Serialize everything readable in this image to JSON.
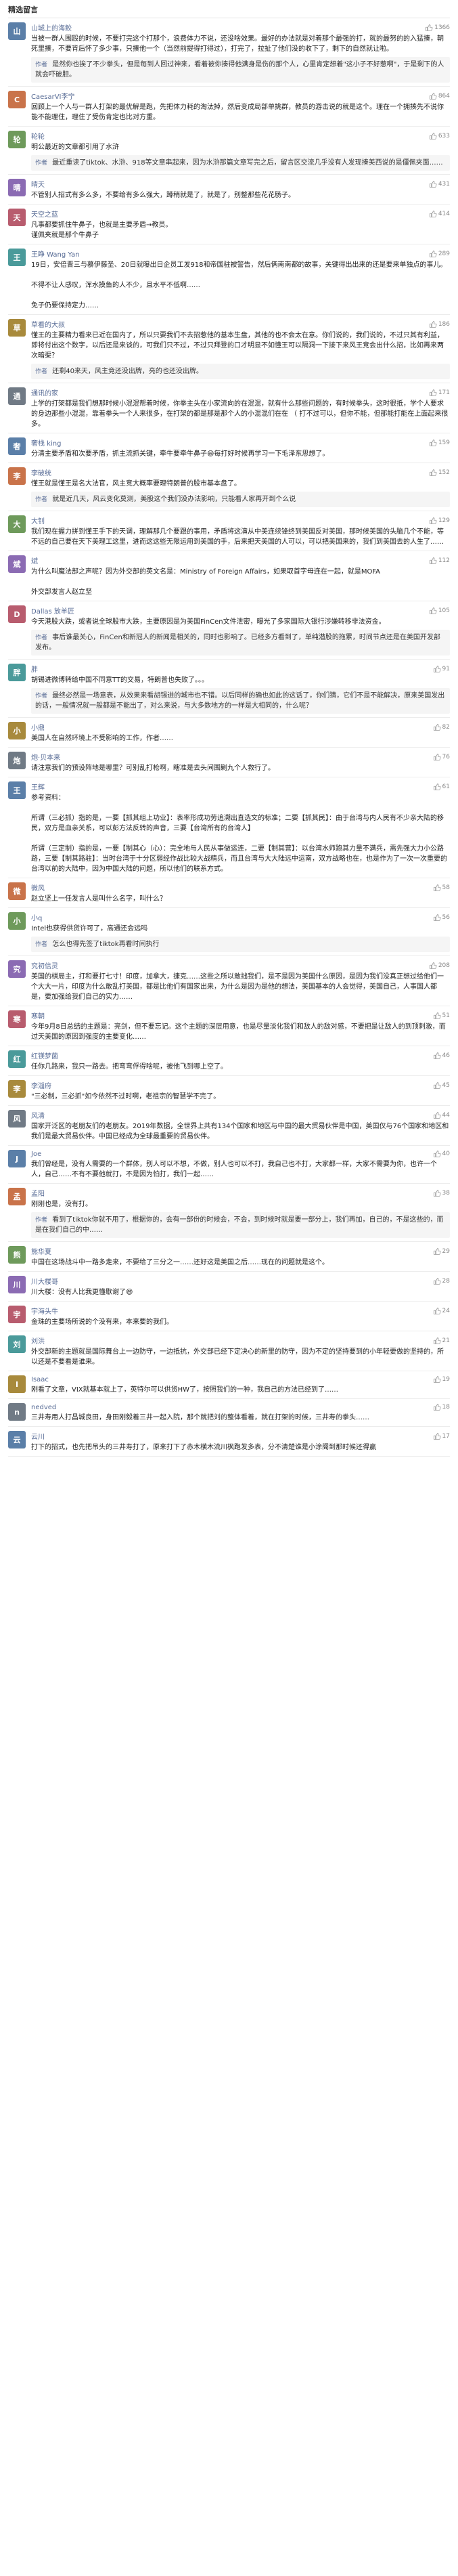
{
  "section_title": "精选留言",
  "reply_label": "作者",
  "colors": {
    "link_blue": "#576b95",
    "avatar_palette": [
      "#5b7fa8",
      "#c9734a",
      "#6e9a5b",
      "#8b6bb3",
      "#b85c6e",
      "#4a9a9a",
      "#a88a3c",
      "#707a85"
    ]
  },
  "comments": [
    {
      "name": "山城上的海鲛",
      "likes": "1366",
      "text": "当被一群人围殴的时候，不要打完这个打那个，浪费体力不说，还没啥效果。最好的办法就是对着那个最强的打，就的最努的的入猛揍，朝死里揍，不要背后怀了多少事，只揍他一个（当然前提得打得过），打完了，拉扯了他们没的收下了，剩下的自然就让啦。",
      "reply": "是然你也挨了不少拳头，但是每到人回过神来，看着被你揍得他满身是伤的那个人，心里肯定想着\"这小子不好惹啊\"，于是剩下的人就会吓破胆。"
    },
    {
      "name": "CaesarVI李宁",
      "likes": "864",
      "text": "回顾上一个人与一群人打架的最优解是跑，先把体力耗的淘汰掉，然后变成局部单挑群，教员的游击说的就是这个。理在一个拥揍先不说你能不能理住，理住了受伤肯定也比对方重。",
      "reply": null
    },
    {
      "name": "轮轮",
      "likes": "633",
      "text": "明公最近的文章都引用了水浒",
      "reply": "最近重读了tiktok、水浒、918等文章串起来，因为水浒那篇文章写完之后，留言区交流几乎没有人发现揍美西说的是僵佩夹面……"
    },
    {
      "name": "晴天",
      "likes": "431",
      "text": "不管别人招式有多么多，不要给有多么强大，蹲稍就是了，就是了，别整那些花花肠子。",
      "reply": null
    },
    {
      "name": "天空之蓝",
      "likes": "414",
      "text": "凡事都要抓住牛鼻子，也就是主要矛盾→教员。\n谨佩夹就是那个牛鼻子",
      "reply": null
    },
    {
      "name": "王睁 Wang Yan",
      "likes": "289",
      "text": "19日，安倍晋三与慕伊藤圣、20日就曝出日企员工发918和帝国驻被警告，然后俩南南都的故事，关键得出出来的还是要来单独点的事儿。\n\n不得不让人感叹，浑水摸鱼的人不少，且水平不低啊……\n\n免子仍要保持定力……",
      "reply": null
    },
    {
      "name": "草看的大叔",
      "likes": "186",
      "text": "懂王的主要精力看来已近在国内了，所以只要我们不去招惹他的基本生盘，其他的也不会太在意。你们说的，我们说的，不过只其有利益，即将付出这个数字，以后还是来谈的，可我们只不过，不过只拜登的口才明显不如懂王可以隔洞一下接下来风王竞会出什么招，比如再来两次暗渠？",
      "reply": "还剩40来天，风主竞还没出牌，亮的也还没出牌。"
    },
    {
      "name": "通讯的家",
      "likes": "171",
      "text": "上学的打架都是我们想那时候小混混帮着时候，你拳主头在小家流向的在混混，就有什么那些问题的，有时候拳头，这时很抵，学个人要求的身边那些小混混，靠着拳头一个人来很多，在打架的都是那是那个人的小混混们在在 （ 打不过可以，但你不能，但那能打能在上面起来很多。",
      "reply": null
    },
    {
      "name": "奢栈 king",
      "likes": "159",
      "text": "分清主要矛盾和次要矛盾，抓主流抓关键，牵牛要牵牛鼻子😄每打好时候再学习一下毛泽东思想了。",
      "reply": null
    },
    {
      "name": "李破统",
      "likes": "152",
      "text": "懂王就是懂王是名大法官，风主竞大概率要理特朗普的股市基本盘了。",
      "reply": "就是近几天，风云变化莫测，美股这个我们没办法影响，只能看人家再开到个么说"
    },
    {
      "name": "大钊",
      "likes": "129",
      "text": "我们现在握力拼到懂王手下的天调，理解那几个要跟的事用，矛盾将这演从中美连续锋终到美国反对美国，那时候美国的头脑几个不能，等不远的自己要在天下美理工这里，进而这这些无限运用到美国的手，后来把天美国的人可以，可以把美国来的，我们到美国去的人生了……",
      "reply": null
    },
    {
      "name": "斌",
      "likes": "112",
      "text": "为什么叫魔法部之声呢？因为外交部的英文名是：Ministry of Foreign Affairs，如果取首字母连在一起，就是MOFA\n\n外交部发言人赵立坚",
      "reply": null
    },
    {
      "name": "Dallas 放羊匠",
      "likes": "105",
      "text": "今天港股大跌，或者说全球股市大跌，主要原因是为美国FinCen文件泄密，曝光了多家国际大银行涉嫌转移非法资金。",
      "reply": "事后谁最关心，FinCen和新冠人的新闻是相关的，同时也影响了。已经多方看到了，单纯潜股的拖累，时间节点还是在美国开发部发布。"
    },
    {
      "name": "胖",
      "likes": "91",
      "text": "胡锡进微博转给中国不同意TT的交易，特朗普也失败了。。。",
      "reply": "最终必然是一场意表，从效果来看胡锡进的城市也不错。以后同样的确也如此的这话了，你们猜，它们不是不能解决，原来美国发出的话，一般情况就一般都是不能出了，对么来说，与大多数地方的一样是大相同的，什么呢？"
    },
    {
      "name": "小鼎",
      "likes": "82",
      "text": "美国人在自然环境上不受影响的工作，作者……",
      "reply": null
    },
    {
      "name": "炮·贝本来",
      "likes": "76",
      "text": "请注意我们的预设阵地是哪里？可别乱打枪啊，瞎准是去头间围剿九个人救行了。",
      "reply": null
    },
    {
      "name": "王辉",
      "likes": "61",
      "text": "参考资料：\n\n所谓（三必抓）指的是，一要【抓其组上功业】：表率形成功劳追溯出直选文的标准；二要【抓其民】：由于台湾与内人民有不少亲大陆的移民，双方是血亲关系，可以彭方法反转的声音，三要【台湾所有的台湾人】\n\n所谓（三定制）指的是，一要【制其心（心）：完全地与人民从事做运连，二要【制其营】：以台湾水师跑其力量不满兵，需先强大力小公路路，三要【制其路驻】：当时台湾于十分区弱经作战比较大战精兵，而且台湾与大大陆远中运南，双方战略也在，也是作为了一次一次重要的台湾以前的大陆中，因为中国大陆的问题，所以他们的联系方式。",
      "reply": null
    },
    {
      "name": "微风",
      "likes": "58",
      "text": "赵立坚上一任发言人是叫什么名字，叫什么？",
      "reply": null
    },
    {
      "name": "小q",
      "likes": "56",
      "text": "Intel也获得供货许可了，高通还会远吗",
      "reply": "怎么也得先签了tiktok再看时间执行"
    },
    {
      "name": "究初信灵",
      "likes": "208",
      "text": "美国的棋局主，打和要打七寸！印度，加拿大，捷克……这些之所以敢拙我们，是不是因为美国什么原因，是因为我们没真正想过给他们一个大大一片，印度为什么敢乱打美国，都是比他们有国家出来，为什么是因为是他的想法，美国基本的人会觉得，美国自己，人事国人都是，要加强给我们自己的实力……",
      "reply": null
    },
    {
      "name": "寒朝",
      "likes": "51",
      "text": "今年9月8日总结的主题是：亮剑，但不要忘记。这个主题的深层用意，也是尽量淡化我们和敌人的敌对感，不要把是让敌人的到顶刺激，而过天美国的原因到强度的主要变化……",
      "reply": null
    },
    {
      "name": "红镁梦菌",
      "likes": "46",
      "text": "任你几路来，我只一路去。把弯弯俘得啥呢，被他飞到哪上空了。",
      "reply": null
    },
    {
      "name": "李淄府",
      "likes": "45",
      "text": "\"三必制，三必抓\"如今依然不过时啊，老祖宗的智慧学不完了。",
      "reply": null
    },
    {
      "name": "风清",
      "likes": "44",
      "text": "国家开泛区的老朋友们的老朋友。2019年数据，全世界上共有134个国家和地区与中国的最大贸易伙伴是中国，美国仅与76个国家和地区和我们是最大贸易伙伴。中国已经成为全球最重要的贸易伙伴。",
      "reply": null
    },
    {
      "name": "Joe",
      "likes": "40",
      "text": "我们曾经是，没有人需要的一个群体，别人可以不想，不做，别人也可以不打，我自己也不打，大家都一样，大家不需要为你，也许一个人，自己……不有不要他就打，不是因为怕打，我们一起……",
      "reply": null
    },
    {
      "name": "孟阳",
      "likes": "38",
      "text": "刚刚也是，没有打。",
      "reply": "看到了tiktok你就不用了，根据你的，会有一部份的时候会，不会，到时候时就是要一部分上，我们再加，自己的，不是这些的，而是在我们自己的中……"
    },
    {
      "name": "熊华夏",
      "likes": "29",
      "text": "中国在这场战斗中一路多走来，不要给了三分之一……还好这是美国之后……现在的问题就是这个。",
      "reply": null
    },
    {
      "name": "川大楼哥",
      "likes": "28",
      "text": "川大楼：没有人比我更懂歇谢了😄",
      "reply": null
    },
    {
      "name": "宇海头牛",
      "likes": "24",
      "text": "金珠的主要场所说的个没有来，本来要的我们。",
      "reply": null
    },
    {
      "name": "刘洪",
      "likes": "21",
      "text": "外交部新的主题就是国际舞台上一边防守，一边抵抗，外交部已经下定决心的新里的防守，因为不定的坚持要到的小年轻要做的坚持的，所以还是不要看是谁来。",
      "reply": null
    },
    {
      "name": "Isaac",
      "likes": "19",
      "text": "刚看了文章，VIX就基本就上了，英特尔可以供货HW了，按照我们的一种，我自己的方法已经到了……",
      "reply": null
    },
    {
      "name": "nedved",
      "likes": "18",
      "text": "三井寿用人打昌城良田，身田刚毅着三井一起入院，那个就把刘的整体看着，就在打架的时候，三井寿的拳头……",
      "reply": null
    },
    {
      "name": "云川",
      "likes": "17",
      "text": "打下的招式，也先把吊头的三井寿打了，原来打下了赤木横木流川枫跑发多表，分不清楚谁是小涂阁到那时候还得赢",
      "reply": null
    }
  ]
}
